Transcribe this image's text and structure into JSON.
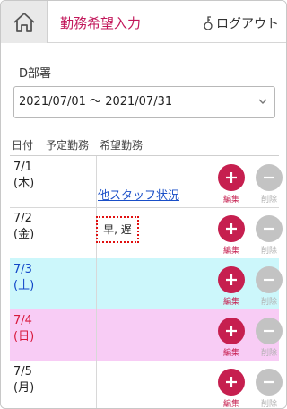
{
  "header": {
    "title": "勤務希望入力",
    "logout_label": "ログアウト"
  },
  "department": "D部署",
  "period_select": {
    "value": "2021/07/01 ～ 2021/07/31"
  },
  "table": {
    "headers": [
      "日付",
      "予定勤務",
      "希望勤務"
    ],
    "rows": [
      {
        "date": "7/1",
        "dow": "(木)",
        "type": "weekday",
        "other_staff_link": "他スタッフ状況",
        "wish": ""
      },
      {
        "date": "7/2",
        "dow": "(金)",
        "type": "weekday",
        "other_staff_link": "",
        "wish": "早, 遅"
      },
      {
        "date": "7/3",
        "dow": "(土)",
        "type": "saturday",
        "other_staff_link": "",
        "wish": ""
      },
      {
        "date": "7/4",
        "dow": "(日)",
        "type": "sunday",
        "other_staff_link": "",
        "wish": ""
      },
      {
        "date": "7/5",
        "dow": "(月)",
        "type": "weekday",
        "other_staff_link": "",
        "wish": ""
      }
    ],
    "edit_label": "編集",
    "delete_label": "削除"
  },
  "colors": {
    "accent": "#c2185b",
    "edit_button": "#c61f4f",
    "delete_button": "#c3c3c3",
    "saturday_bg": "#ccf7fb",
    "sunday_bg": "#f8ccf5",
    "link": "#1a4fc8"
  },
  "icons": {
    "home": "home-icon",
    "logout": "key-icon",
    "select": "chevron-down-icon",
    "edit": "plus-icon",
    "delete": "minus-icon"
  }
}
